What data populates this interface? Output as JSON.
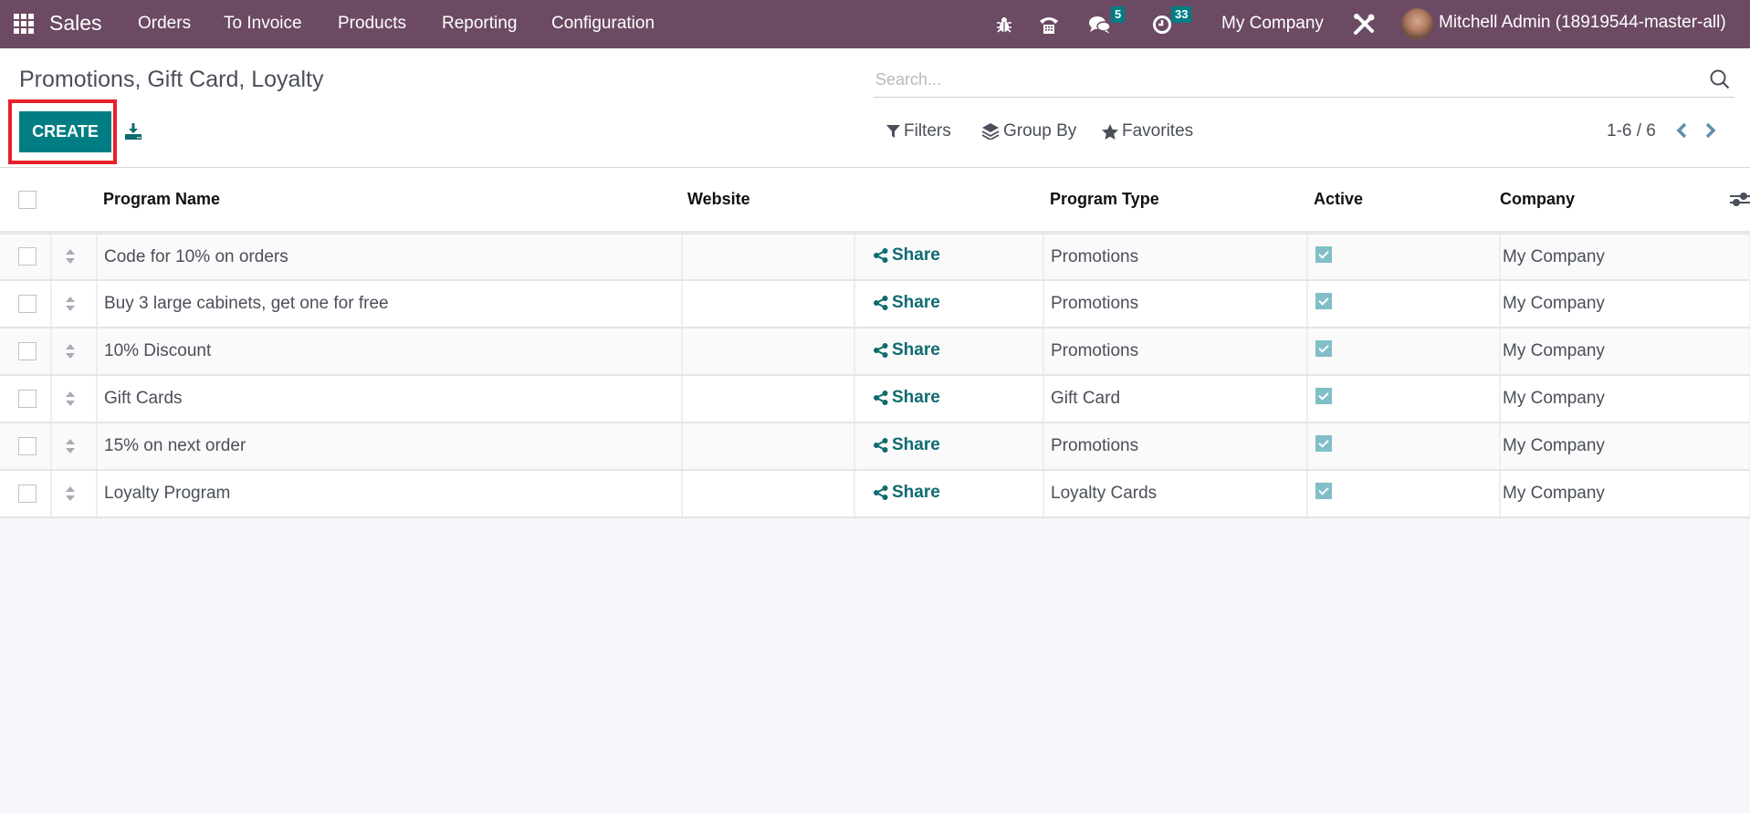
{
  "navbar": {
    "app_name": "Sales",
    "menu": [
      "Orders",
      "To Invoice",
      "Products",
      "Reporting",
      "Configuration"
    ],
    "icons": [
      "bug-icon",
      "phone-icon",
      "chat-icon",
      "clock-icon",
      "tools-icon"
    ],
    "messages_badge": "5",
    "activities_badge": "33",
    "company": "My Company",
    "user": "Mitchell Admin (18919544-master-all)"
  },
  "control_panel": {
    "title": "Promotions, Gift Card, Loyalty",
    "create_label": "CREATE",
    "search_placeholder": "Search...",
    "filters_label": "Filters",
    "groupby_label": "Group By",
    "favorites_label": "Favorites",
    "pager": "1-6 / 6"
  },
  "colors": {
    "navbar": "#6c4a63",
    "primary": "#017e84",
    "highlight": "#e8202a"
  },
  "table": {
    "columns": [
      "Program Name",
      "Website",
      "",
      "Program Type",
      "Active",
      "Company"
    ],
    "share_label": "Share",
    "rows": [
      {
        "name": "Code for 10% on orders",
        "website": "",
        "type": "Promotions",
        "active": true,
        "company": "My Company"
      },
      {
        "name": "Buy 3 large cabinets, get one for free",
        "website": "",
        "type": "Promotions",
        "active": true,
        "company": "My Company"
      },
      {
        "name": "10% Discount",
        "website": "",
        "type": "Promotions",
        "active": true,
        "company": "My Company"
      },
      {
        "name": "Gift Cards",
        "website": "",
        "type": "Gift Card",
        "active": true,
        "company": "My Company"
      },
      {
        "name": "15% on next order",
        "website": "",
        "type": "Promotions",
        "active": true,
        "company": "My Company"
      },
      {
        "name": "Loyalty Program",
        "website": "",
        "type": "Loyalty Cards",
        "active": true,
        "company": "My Company"
      }
    ]
  }
}
